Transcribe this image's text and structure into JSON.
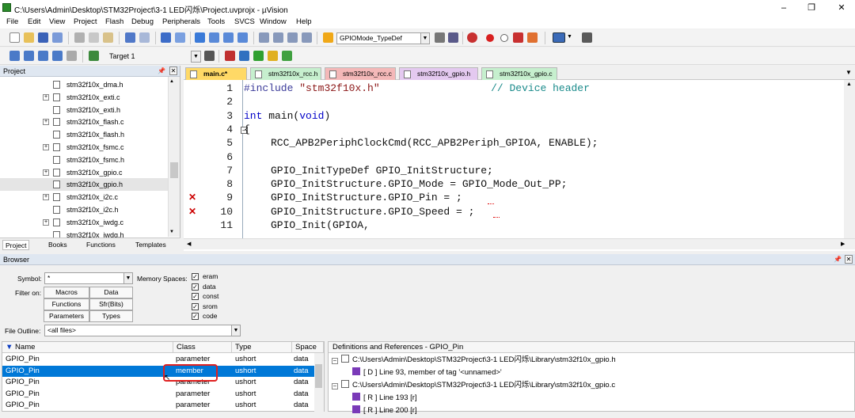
{
  "window": {
    "title": "C:\\Users\\Admin\\Desktop\\STM32Project\\3-1 LED闪烁\\Project.uvprojx - µVision",
    "min": "–",
    "max": "❐",
    "close": "✕"
  },
  "menu": [
    "File",
    "Edit",
    "View",
    "Project",
    "Flash",
    "Debug",
    "Peripherals",
    "Tools",
    "SVCS",
    "Window",
    "Help"
  ],
  "toolbar1": {
    "find_combo": "GPIOMode_TypeDef"
  },
  "toolbar2": {
    "target_combo": "Target 1"
  },
  "project": {
    "title": "Project",
    "files": [
      {
        "name": "stm32f10x_dma.h",
        "expandable": false
      },
      {
        "name": "stm32f10x_exti.c",
        "expandable": true
      },
      {
        "name": "stm32f10x_exti.h",
        "expandable": false
      },
      {
        "name": "stm32f10x_flash.c",
        "expandable": true
      },
      {
        "name": "stm32f10x_flash.h",
        "expandable": false
      },
      {
        "name": "stm32f10x_fsmc.c",
        "expandable": true
      },
      {
        "name": "stm32f10x_fsmc.h",
        "expandable": false
      },
      {
        "name": "stm32f10x_gpio.c",
        "expandable": true
      },
      {
        "name": "stm32f10x_gpio.h",
        "expandable": false,
        "selected": true
      },
      {
        "name": "stm32f10x_i2c.c",
        "expandable": true
      },
      {
        "name": "stm32f10x_i2c.h",
        "expandable": false
      },
      {
        "name": "stm32f10x_iwdg.c",
        "expandable": true
      },
      {
        "name": "stm32f10x_iwdg.h",
        "expandable": false
      }
    ],
    "tabs": [
      "Project",
      "Books",
      "Functions",
      "Templates"
    ]
  },
  "editor": {
    "tabs": [
      {
        "label": "main.c*",
        "color": "#ffd966",
        "active": true
      },
      {
        "label": "stm32f10x_rcc.h",
        "color": "#c6efce"
      },
      {
        "label": "stm32f10x_rcc.c",
        "color": "#f4b8b8"
      },
      {
        "label": "stm32f10x_gpio.h",
        "color": "#e4c9f0"
      },
      {
        "label": "stm32f10x_gpio.c",
        "color": "#c6efce"
      }
    ],
    "lines": [
      {
        "n": "1",
        "err": false
      },
      {
        "n": "2",
        "err": false
      },
      {
        "n": "3",
        "err": false
      },
      {
        "n": "4",
        "err": false
      },
      {
        "n": "5",
        "err": false
      },
      {
        "n": "6",
        "err": false
      },
      {
        "n": "7",
        "err": false
      },
      {
        "n": "8",
        "err": false
      },
      {
        "n": "9",
        "err": true
      },
      {
        "n": "10",
        "err": true
      },
      {
        "n": "11",
        "err": false
      }
    ],
    "code": {
      "l1_pp": "#include",
      "l1_str": "\"stm32f10x.h\"",
      "l1_cm": "// Device header",
      "l3_kw1": "int",
      "l3_rest1": " main(",
      "l3_kw2": "void",
      "l3_rest2": ")",
      "l4": "{",
      "l5": "RCC_APB2PeriphClockCmd(RCC_APB2Periph_GPIOA, ENABLE);",
      "l7": "GPIO_InitTypeDef GPIO_InitStructure;",
      "l8": "GPIO_InitStructure.GPIO_Mode = GPIO_Mode_Out_PP;",
      "l9": "GPIO_InitStructure.GPIO_Pin = ;",
      "l10": "GPIO_InitStructure.GPIO_Speed = ;",
      "l11": "GPIO_Init(GPIOA,"
    }
  },
  "browser": {
    "title": "Browser",
    "symbol_label": "Symbol:",
    "symbol_value": "*",
    "memspaces_label": "Memory Spaces:",
    "memspaces": [
      "eram",
      "data",
      "const",
      "srom",
      "code"
    ],
    "filteron_label": "Filter on:",
    "filters": [
      "Macros",
      "Data",
      "Functions",
      "Sfr(Bits)",
      "Parameters",
      "Types"
    ],
    "outline_label": "File Outline:",
    "outline_value": "<all files>",
    "columns": [
      "Name",
      "Class",
      "Type",
      "Space"
    ],
    "rows": [
      {
        "name": "GPIO_Pin",
        "cls": "parameter",
        "type": "ushort",
        "space": "data"
      },
      {
        "name": "GPIO_Pin",
        "cls": "member",
        "type": "ushort",
        "space": "data",
        "selected": true
      },
      {
        "name": "GPIO_Pin",
        "cls": "parameter",
        "type": "ushort",
        "space": "data"
      },
      {
        "name": "GPIO_Pin",
        "cls": "parameter",
        "type": "ushort",
        "space": "data"
      },
      {
        "name": "GPIO_Pin",
        "cls": "parameter",
        "type": "ushort",
        "space": "data"
      }
    ],
    "defs_title": "Definitions and References - GPIO_Pin",
    "defs": [
      {
        "indent": 0,
        "text": "C:\\Users\\Admin\\Desktop\\STM32Project\\3-1 LED闪烁\\Library\\stm32f10x_gpio.h"
      },
      {
        "indent": 1,
        "text": "[ D ] Line 93, member of tag '<unnamed>'"
      },
      {
        "indent": 0,
        "text": "C:\\Users\\Admin\\Desktop\\STM32Project\\3-1 LED闪烁\\Library\\stm32f10x_gpio.c"
      },
      {
        "indent": 1,
        "text": "[ R ] Line 193 [r]"
      },
      {
        "indent": 1,
        "text": "[ R ] Line 200 [r]"
      }
    ]
  }
}
